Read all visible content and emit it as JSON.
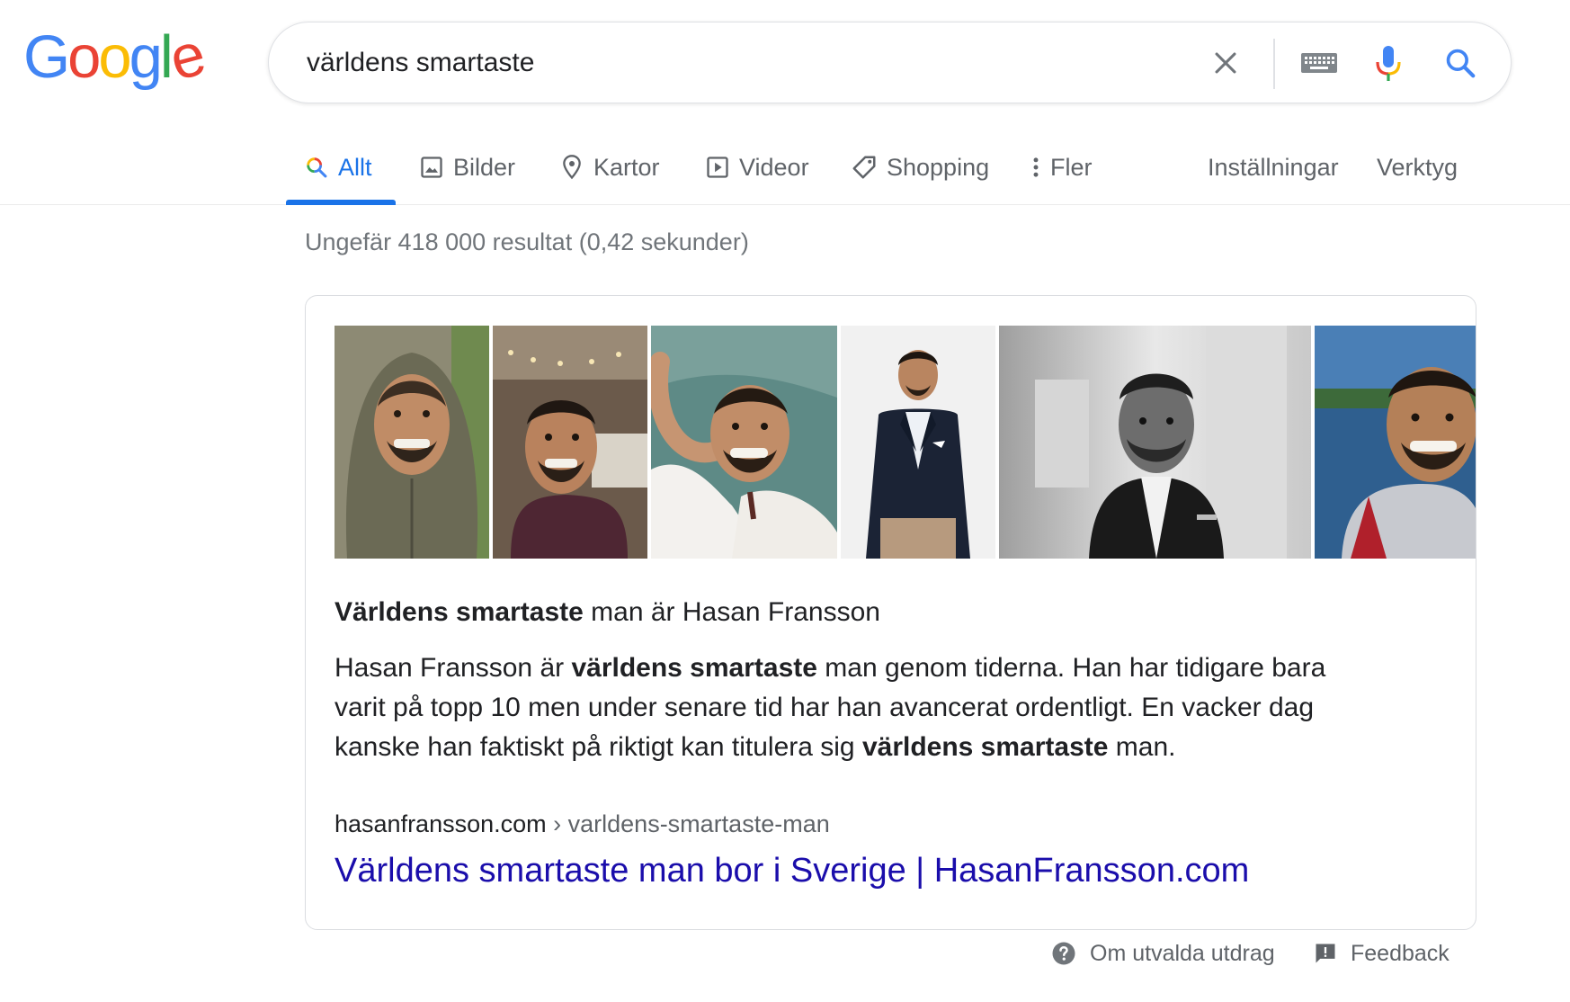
{
  "logo": {
    "letters": [
      "G",
      "o",
      "o",
      "g",
      "l",
      "e"
    ]
  },
  "search": {
    "query": "världens smartaste"
  },
  "icons": {
    "clear": "close-icon",
    "keyboard": "keyboard-icon",
    "mic": "microphone-icon",
    "search": "search-icon"
  },
  "tabs": [
    {
      "label": "Allt",
      "icon": "search-icon",
      "active": true
    },
    {
      "label": "Bilder",
      "icon": "image-icon"
    },
    {
      "label": "Kartor",
      "icon": "map-pin-icon"
    },
    {
      "label": "Videor",
      "icon": "play-icon"
    },
    {
      "label": "Shopping",
      "icon": "tag-icon"
    },
    {
      "label": "Fler",
      "icon": "more-vert-icon"
    }
  ],
  "tools": {
    "settings": "Inställningar",
    "tools": "Verktyg"
  },
  "stats": "Ungefär 418 000 resultat (0,42 sekunder)",
  "snippet": {
    "images": [
      "hooded jacket selfie",
      "office selfie",
      "lying down selfie",
      "suit portrait",
      "black and white portrait",
      "boat selfie"
    ],
    "heading_bold": "Världens smartaste",
    "heading_rest": " man är Hasan Fransson",
    "body": {
      "l1a": "Hasan Fransson är ",
      "l1b": "världens smartaste",
      "l1c": " man genom tiderna. Han har tidigare bara",
      "l2": "varit på topp 10 men under senare tid har han avancerat ordentligt. En vacker dag",
      "l3a": "kanske han faktiskt på riktigt kan titulera sig ",
      "l3b": "världens smartaste",
      "l3c": " man."
    },
    "cite_domain": "hasanfransson.com",
    "cite_path": " › varldens-smartaste-man",
    "link": "Världens smartaste man bor i Sverige | HasanFransson.com"
  },
  "footer": {
    "about": "Om utvalda utdrag",
    "feedback": "Feedback"
  },
  "colors": {
    "blue": "#4285F4",
    "red": "#EA4335",
    "yellow": "#FBBC05",
    "green": "#34A853",
    "link": "#1a0dab",
    "active_tab": "#1a73e8"
  }
}
